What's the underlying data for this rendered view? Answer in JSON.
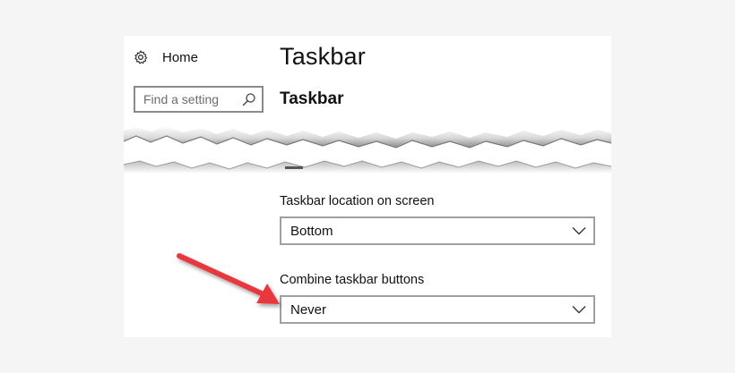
{
  "nav": {
    "home_label": "Home",
    "home_icon": "gear-icon"
  },
  "search": {
    "placeholder": "Find a setting",
    "icon": "search-icon"
  },
  "page": {
    "title": "Taskbar",
    "section_title": "Taskbar"
  },
  "settings": {
    "location": {
      "label": "Taskbar location on screen",
      "value": "Bottom"
    },
    "combine": {
      "label": "Combine taskbar buttons",
      "value": "Never"
    }
  },
  "annotation": {
    "arrow_color": "#e8383d",
    "arrow_icon": "red-arrow-annotation"
  }
}
